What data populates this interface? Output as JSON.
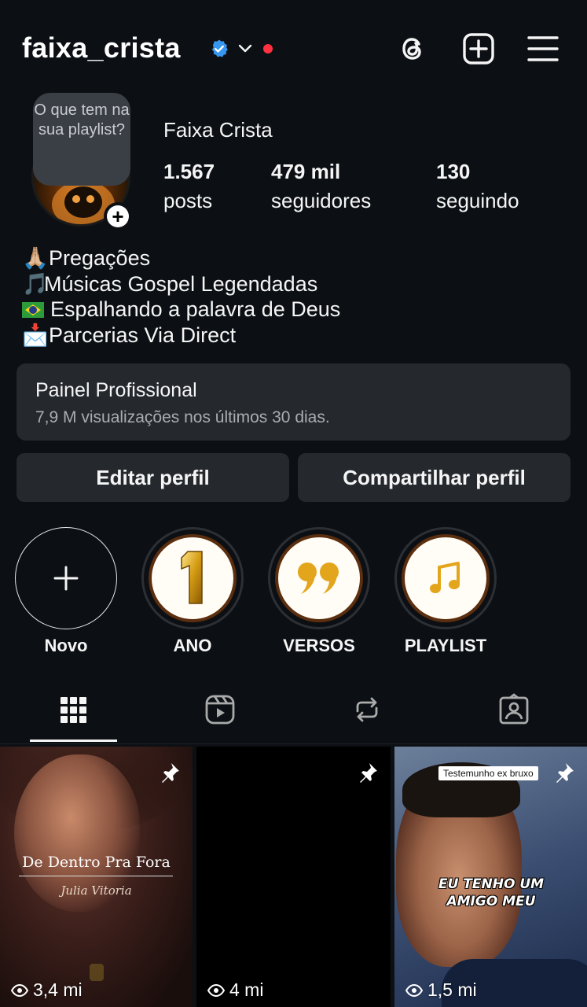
{
  "header": {
    "username": "faixa_crista",
    "colors": {
      "verified": "#3797f0",
      "notification_dot": "#ff3040"
    },
    "icons": [
      "threads-icon",
      "create-post-icon",
      "menu-icon"
    ]
  },
  "profile": {
    "note": "O que tem na sua playlist?",
    "display_name": "Faixa Crista",
    "stats": [
      {
        "value": "1.567",
        "label": "posts"
      },
      {
        "value": "479 mil",
        "label": "seguidores"
      },
      {
        "value": "130",
        "label": "seguindo"
      }
    ],
    "bio": [
      {
        "emoji": "🙏🏼",
        "text": "Pregações"
      },
      {
        "emoji": "🎵",
        "text": "Músicas Gospel Legendadas"
      },
      {
        "emoji": "brazil-flag",
        "text": "Espalhando a palavra de Deus"
      },
      {
        "emoji": "📩",
        "text": "Parcerias Via Direct"
      }
    ]
  },
  "dashboard": {
    "title": "Painel Profissional",
    "subtitle": "7,9 M visualizações nos últimos 30 dias."
  },
  "actions": {
    "edit": "Editar perfil",
    "share": "Compartilhar perfil"
  },
  "highlights": [
    {
      "label": "Novo",
      "icon": "plus-icon"
    },
    {
      "label": "ANO",
      "icon": "gold-number-one-icon"
    },
    {
      "label": "VERSOS",
      "icon": "quote-icon"
    },
    {
      "label": "PLAYLIST",
      "icon": "music-note-icon"
    }
  ],
  "tabs": [
    "grid-tab",
    "reels-tab",
    "reposts-tab",
    "tagged-tab"
  ],
  "posts": [
    {
      "title": "De Dentro Pra Fora",
      "subtitle": "Julia Vitoria",
      "views": "3,4 mi",
      "pinned": true
    },
    {
      "views": "4 mi",
      "pinned": true
    },
    {
      "tag": "Testemunho ex bruxo",
      "caption": "EU TENHO UM AMIGO MEU",
      "views": "1,5 mi",
      "pinned": true
    }
  ]
}
